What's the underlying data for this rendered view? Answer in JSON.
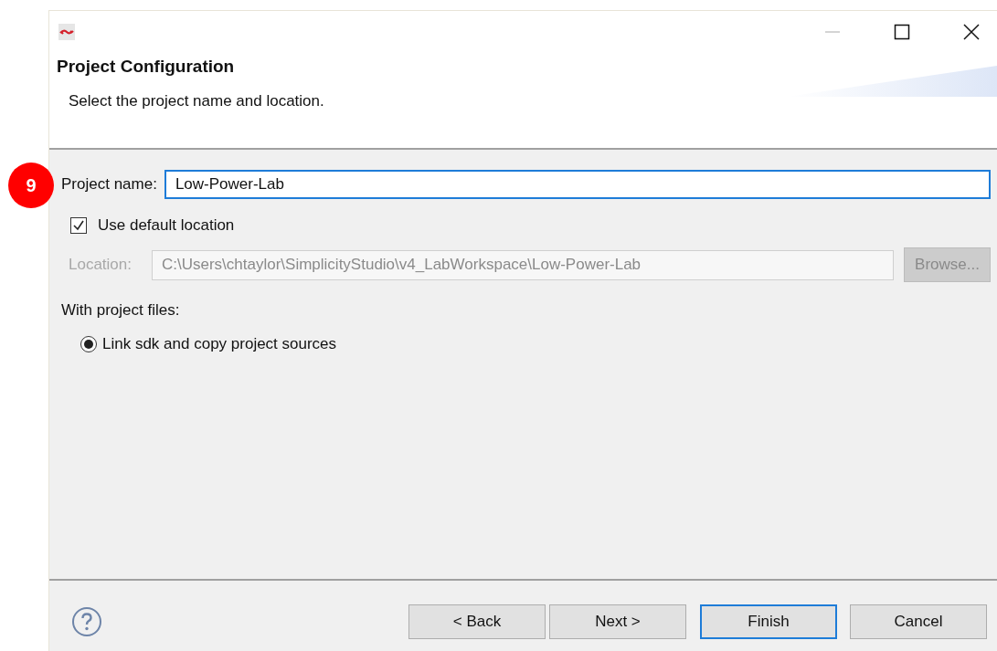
{
  "step_badge": "9",
  "window": {
    "controls": [
      {
        "kind": "minimize"
      },
      {
        "kind": "maximize"
      },
      {
        "kind": "close"
      }
    ]
  },
  "header": {
    "title": "Project Configuration",
    "description": "Select the project name and location."
  },
  "project_name": {
    "label": "Project name:",
    "value": "Low-Power-Lab"
  },
  "use_default_location": {
    "label": "Use default location",
    "checked": true
  },
  "location": {
    "label": "Location:",
    "value": "C:\\Users\\chtaylor\\SimplicityStudio\\v4_LabWorkspace\\Low-Power-Lab",
    "disabled": true,
    "browse": "Browse..."
  },
  "project_files": {
    "label": "With project files:",
    "options": [
      {
        "label": "Link sdk and copy project sources",
        "selected": true
      }
    ]
  },
  "buttons": [
    {
      "label": "< Back",
      "default": false
    },
    {
      "label": "Next >",
      "default": false
    },
    {
      "label": "Finish",
      "default": true
    },
    {
      "label": "Cancel",
      "default": false
    }
  ]
}
